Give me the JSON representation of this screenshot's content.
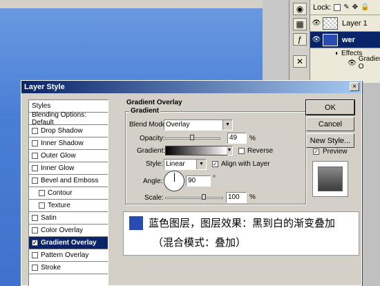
{
  "layers_panel": {
    "lock_label": "Lock:",
    "lock_icons": [
      "checkerboard-icon",
      "brush-icon",
      "move-icon",
      "lock-icon"
    ],
    "layers": [
      {
        "name": "Layer 1",
        "thumb": "checker"
      },
      {
        "name": "wer",
        "thumb": "blue",
        "selected": true
      }
    ],
    "effects_label": "Effects",
    "effect_item": "Gradient O"
  },
  "dialog": {
    "title": "Layer Style",
    "close_glyph": "×",
    "style_list": [
      {
        "label": "Styles",
        "checkbox": false
      },
      {
        "label": "Blending Options: Default",
        "checkbox": false
      },
      {
        "label": "Drop Shadow",
        "checkbox": true,
        "checked": false
      },
      {
        "label": "Inner Shadow",
        "checkbox": true,
        "checked": false
      },
      {
        "label": "Outer Glow",
        "checkbox": true,
        "checked": false
      },
      {
        "label": "Inner Glow",
        "checkbox": true,
        "checked": false
      },
      {
        "label": "Bevel and Emboss",
        "checkbox": true,
        "checked": false
      },
      {
        "label": "Contour",
        "checkbox": true,
        "checked": false,
        "indent": true
      },
      {
        "label": "Texture",
        "checkbox": true,
        "checked": false,
        "indent": true
      },
      {
        "label": "Satin",
        "checkbox": true,
        "checked": false
      },
      {
        "label": "Color Overlay",
        "checkbox": true,
        "checked": false
      },
      {
        "label": "Gradient Overlay",
        "checkbox": true,
        "checked": true,
        "selected": true
      },
      {
        "label": "Pattern Overlay",
        "checkbox": true,
        "checked": false
      },
      {
        "label": "Stroke",
        "checkbox": true,
        "checked": false
      }
    ],
    "section_title": "Gradient Overlay",
    "group_title": "Gradient",
    "blend_mode_label": "Blend Mode:",
    "blend_mode_value": "Overlay",
    "opacity_label": "Opacity:",
    "opacity_value": "49",
    "opacity_unit": "%",
    "opacity_fraction": 0.49,
    "gradient_label": "Gradient:",
    "gradient_from": "#000000",
    "gradient_to": "#ffffff",
    "reverse_label": "Reverse",
    "style_label": "Style:",
    "style_value": "Linear",
    "align_label": "Align with Layer",
    "angle_label": "Angle:",
    "angle_value": "90",
    "angle_unit": "°",
    "scale_label": "Scale:",
    "scale_value": "100",
    "scale_unit": "%",
    "scale_fraction": 0.67,
    "buttons": {
      "ok": "OK",
      "cancel": "Cancel",
      "new_style": "New Style...",
      "preview": "Preview"
    }
  },
  "note": {
    "line1": "蓝色图层，图层效果：黑到白的渐变叠加",
    "line2": "（混合模式：叠加）",
    "swatch_color": "#2a4bb0"
  }
}
